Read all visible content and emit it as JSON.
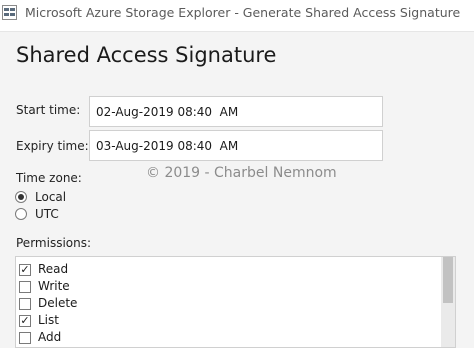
{
  "window": {
    "title": "Microsoft Azure Storage Explorer - Generate Shared Access Signature"
  },
  "dialog": {
    "heading": "Shared Access Signature",
    "start_time": {
      "label": "Start time:",
      "value": "02-Aug-2019 08:40  AM"
    },
    "expiry_time": {
      "label": "Expiry time:",
      "value": "03-Aug-2019 08:40  AM"
    },
    "watermark": "© 2019 - Charbel Nemnom",
    "time_zone": {
      "label": "Time zone:",
      "options": [
        {
          "label": "Local",
          "selected": true
        },
        {
          "label": "UTC",
          "selected": false
        }
      ]
    },
    "permissions": {
      "label": "Permissions:",
      "items": [
        {
          "label": "Read",
          "checked": true
        },
        {
          "label": "Write",
          "checked": false
        },
        {
          "label": "Delete",
          "checked": false
        },
        {
          "label": "List",
          "checked": true
        },
        {
          "label": "Add",
          "checked": false
        }
      ]
    }
  }
}
